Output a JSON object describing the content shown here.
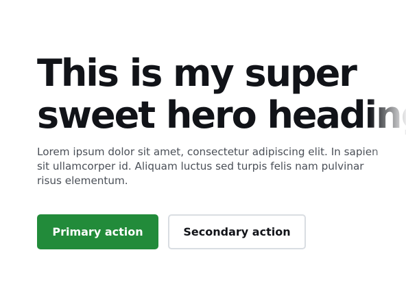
{
  "hero": {
    "heading_line_1": "This is my super",
    "heading_line_2": "sweet hero heading",
    "text": "Lorem ipsum dolor sit amet, consectetur adipiscing elit. In sapien sit ullamcorper id. Aliquam luctus sed turpis felis nam pulvinar risus elementum."
  },
  "actions": {
    "primary_label": "Primary action",
    "secondary_label": "Secondary action"
  },
  "colors": {
    "primary_button": "#228b3a",
    "heading_text": "#111318",
    "body_text": "#4a4f57",
    "secondary_border": "#d9dde2",
    "background": "#ffffff"
  }
}
